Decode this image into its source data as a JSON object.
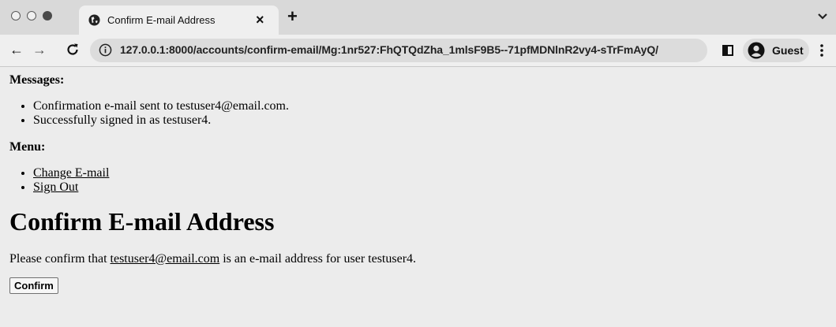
{
  "browser": {
    "tab": {
      "title": "Confirm E-mail Address",
      "close_label": "×",
      "favicon": "globe-icon"
    },
    "new_tab_label": "+",
    "address": {
      "host": "127.0.0.1",
      "rest": ":8000/accounts/confirm-email/Mg:1nr527:FhQTQdZha_1mlsF9B5--71pfMDNlnR2vy4-sTrFmAyQ/"
    },
    "profile": {
      "name": "Guest"
    },
    "nav": {
      "back": "←",
      "forward": "→"
    }
  },
  "page": {
    "messages_heading": "Messages:",
    "messages": [
      "Confirmation e-mail sent to testuser4@email.com.",
      "Successfully signed in as testuser4."
    ],
    "menu_heading": "Menu:",
    "menu": [
      {
        "label": "Change E-mail"
      },
      {
        "label": "Sign Out"
      }
    ],
    "title": "Confirm E-mail Address",
    "body": {
      "before": "Please confirm that ",
      "email": "testuser4@email.com",
      "after": " is an e-mail address for user testuser4."
    },
    "confirm_label": "Confirm"
  }
}
